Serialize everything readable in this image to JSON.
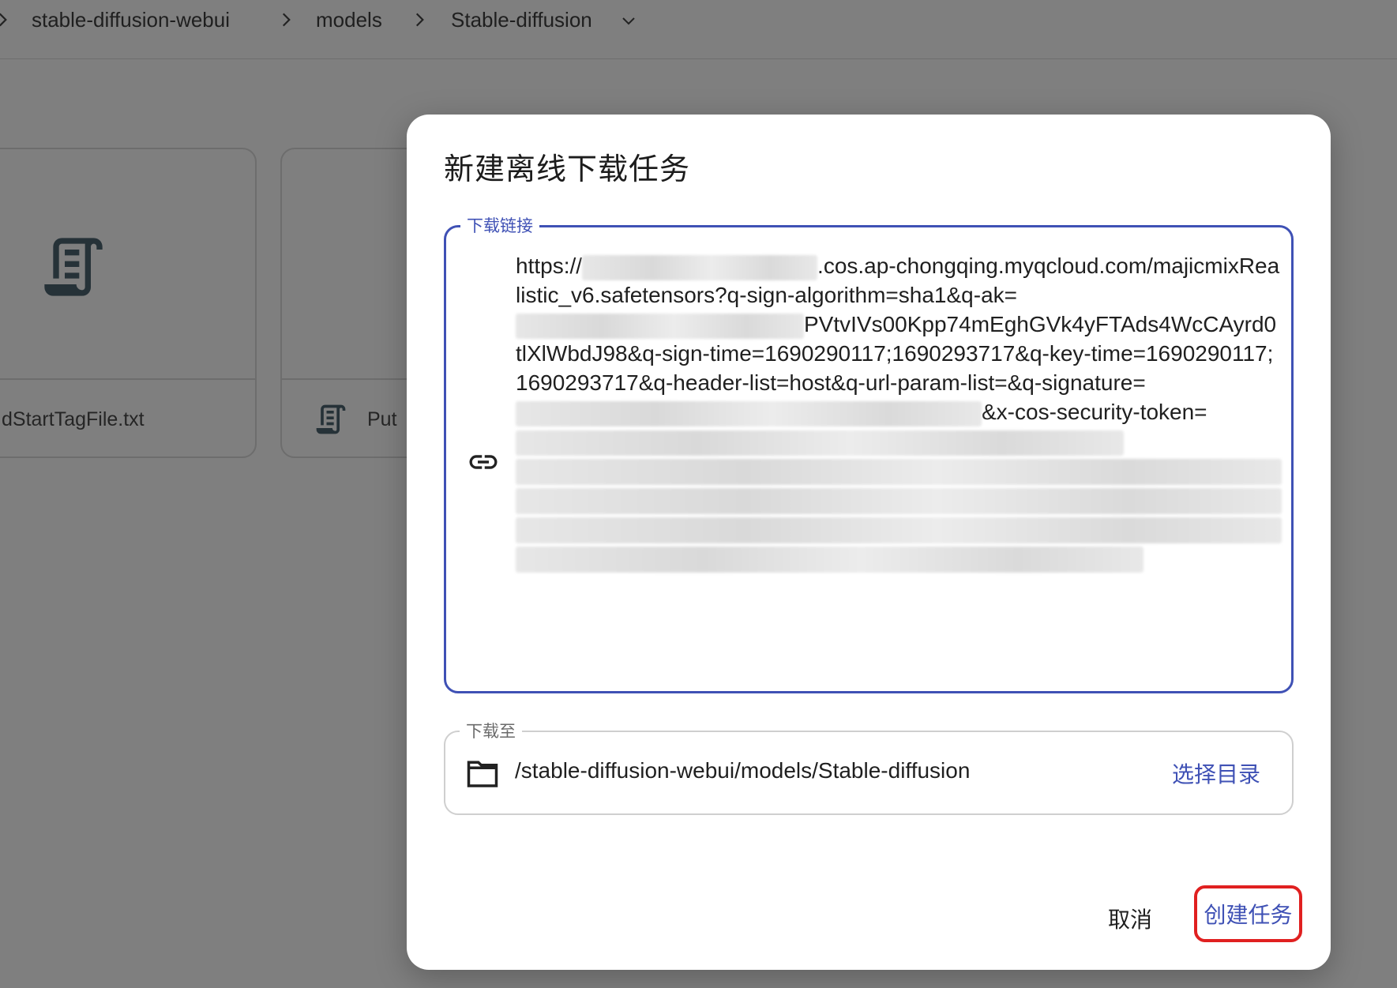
{
  "breadcrumb": {
    "items": [
      "stable-diffusion-webui",
      "models",
      "Stable-diffusion"
    ]
  },
  "background": {
    "cards": [
      {
        "name": "dStartTagFile.txt"
      },
      {
        "name": "Put"
      }
    ]
  },
  "dialog": {
    "title": "新建离线下载任务",
    "url_field": {
      "legend": "下载链接",
      "seg1": "https://",
      "seg2": ".cos.ap-chongqing.myqcloud.com/majicmixRealistic_v6.safetensors?q-sign-algorithm=sha1&q-ak=",
      "seg3": "PVtvIVs00Kpp74mEghGVk4yFTAds4WcCAyrd0tlXlWbdJ98&q-sign-time=1690290117;1690293717&q-key-time=1690290117;1690293717&q-header-list=host&q-url-param-list=&q-signature=",
      "seg4": "&x-cos-security-token="
    },
    "dest_field": {
      "legend": "下载至",
      "path": "/stable-diffusion-webui/models/Stable-diffusion",
      "choose_label": "选择目录"
    },
    "actions": {
      "cancel_label": "取消",
      "create_label": "创建任务"
    }
  },
  "colors": {
    "accent": "#3f51b5",
    "highlight": "#e02020",
    "overlay": "#7f7f7f"
  }
}
